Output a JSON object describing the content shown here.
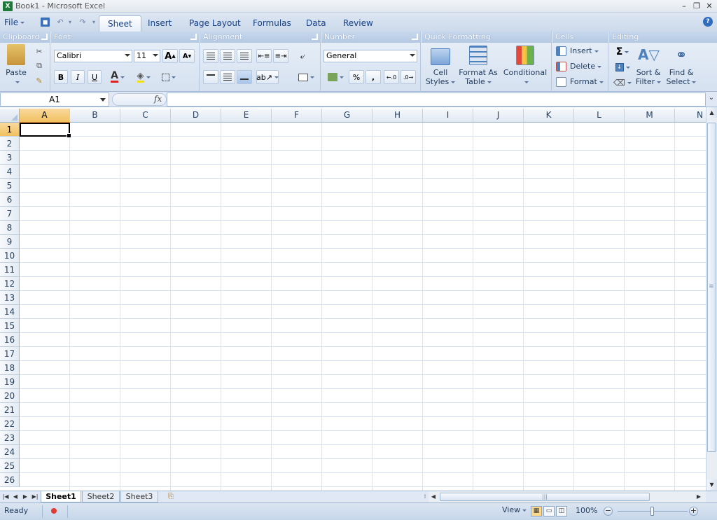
{
  "window": {
    "title": "Book1 - Microsoft Excel",
    "app_icon": "excel-icon",
    "controls": [
      "minimize",
      "restore",
      "close"
    ]
  },
  "menu": {
    "file_label": "File",
    "tabs": [
      {
        "label": "Sheet",
        "active": true
      },
      {
        "label": "Insert",
        "active": false
      },
      {
        "label": "Page Layout",
        "active": false
      },
      {
        "label": "Formulas",
        "active": false
      },
      {
        "label": "Data",
        "active": false
      },
      {
        "label": "Review",
        "active": false
      }
    ],
    "quick_access": [
      "save-icon",
      "undo-icon",
      "redo-icon",
      "customize-icon"
    ],
    "help_icon": "help-icon"
  },
  "ribbon": {
    "clipboard": {
      "title": "Clipboard",
      "paste_label": "Paste"
    },
    "font": {
      "title": "Font",
      "font_name": "Calibri",
      "font_size": "11",
      "bold": "B",
      "italic": "I",
      "underline": "U",
      "font_color_letter": "A"
    },
    "alignment": {
      "title": "Alignment"
    },
    "number": {
      "title": "Number",
      "format": "General",
      "percent": "%",
      "comma": ","
    },
    "quick_formatting": {
      "title": "Quick Formatting",
      "cell_styles": [
        "Cell",
        "Styles"
      ],
      "format_as_table": [
        "Format As",
        "Table"
      ],
      "conditional": "Conditional"
    },
    "cells": {
      "title": "Cells",
      "insert": "Insert",
      "delete": "Delete",
      "format": "Format"
    },
    "editing": {
      "title": "Editing",
      "sum": "Σ",
      "sort_filter": [
        "Sort &",
        "Filter"
      ],
      "find_select": [
        "Find &",
        "Select"
      ]
    }
  },
  "formula_bar": {
    "name_box": "A1",
    "fx": "fx",
    "value": ""
  },
  "grid": {
    "columns": [
      "A",
      "B",
      "C",
      "D",
      "E",
      "F",
      "G",
      "H",
      "I",
      "J",
      "K",
      "L",
      "M",
      "N"
    ],
    "rows": [
      "1",
      "2",
      "3",
      "4",
      "5",
      "6",
      "7",
      "8",
      "9",
      "10",
      "11",
      "12",
      "13",
      "14",
      "15",
      "16",
      "17",
      "18",
      "19",
      "20",
      "21",
      "22",
      "23",
      "24",
      "25",
      "26"
    ],
    "active_cell": "A1",
    "selection_color": "#f1c15f"
  },
  "sheets": {
    "tabs": [
      {
        "label": "Sheet1",
        "active": true
      },
      {
        "label": "Sheet2",
        "active": false
      },
      {
        "label": "Sheet3",
        "active": false
      }
    ]
  },
  "status_bar": {
    "status": "Ready",
    "view_label": "View",
    "zoom": "100%",
    "zoom_fraction": 0.5
  }
}
